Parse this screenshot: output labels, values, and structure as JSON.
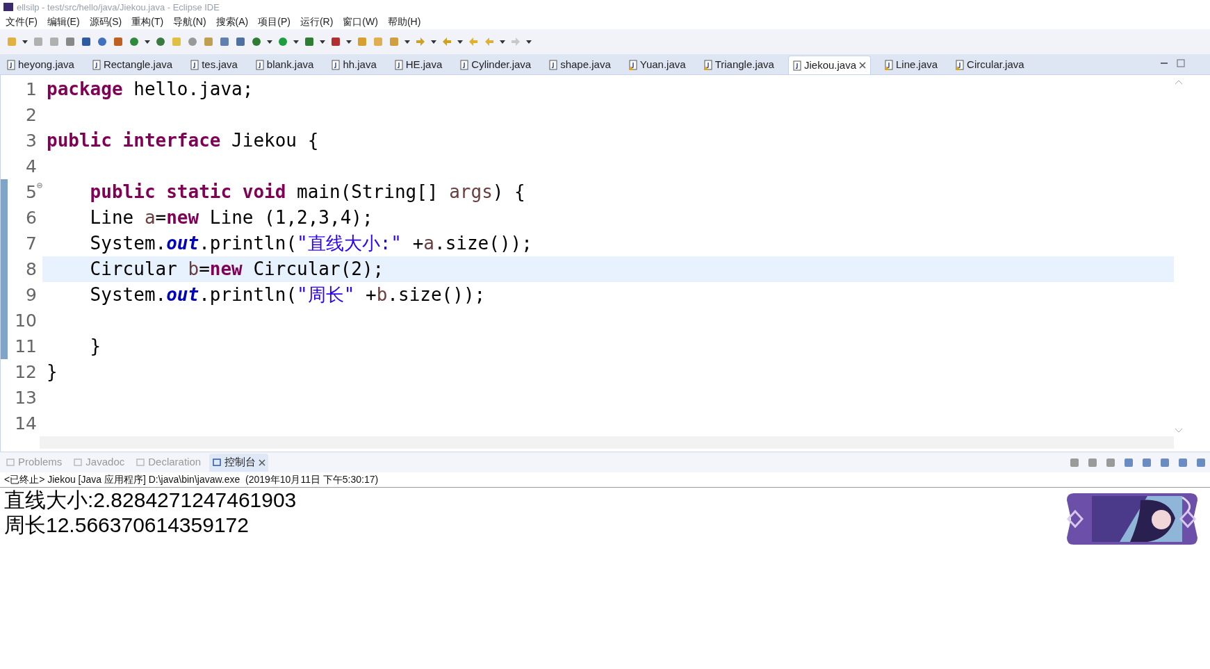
{
  "window": {
    "title": "ellsilp - test/src/hello/java/Jiekou.java - Eclipse IDE"
  },
  "menu": [
    "文件(F)",
    "编辑(E)",
    "源码(S)",
    "重构(T)",
    "导航(N)",
    "搜索(A)",
    "项目(P)",
    "运行(R)",
    "窗口(W)",
    "帮助(H)"
  ],
  "editor_tabs": [
    {
      "label": "heyong.java",
      "selected": false,
      "warning": false
    },
    {
      "label": "Rectangle.java",
      "selected": false,
      "warning": false
    },
    {
      "label": "tes.java",
      "selected": false,
      "warning": false
    },
    {
      "label": "blank.java",
      "selected": false,
      "warning": false
    },
    {
      "label": "hh.java",
      "selected": false,
      "warning": false
    },
    {
      "label": "HE.java",
      "selected": false,
      "warning": false
    },
    {
      "label": "Cylinder.java",
      "selected": false,
      "warning": false
    },
    {
      "label": "shape.java",
      "selected": false,
      "warning": false
    },
    {
      "label": "Yuan.java",
      "selected": false,
      "warning": true
    },
    {
      "label": "Triangle.java",
      "selected": false,
      "warning": true
    },
    {
      "label": "Jiekou.java",
      "selected": true,
      "warning": false
    },
    {
      "label": "Line.java",
      "selected": false,
      "warning": true
    },
    {
      "label": "Circular.java",
      "selected": false,
      "warning": true
    }
  ],
  "code_lines": [
    {
      "number": "1",
      "selected": false,
      "changed": false,
      "foldable": false,
      "tokens": [
        {
          "kind": "kw",
          "text": "package"
        },
        {
          "kind": "plain",
          "text": " hello.java;"
        }
      ]
    },
    {
      "number": "2",
      "selected": false,
      "changed": false,
      "foldable": false
    },
    {
      "number": "3",
      "selected": false,
      "changed": false,
      "foldable": false,
      "tokens": [
        {
          "kind": "kw",
          "text": "public interface"
        },
        {
          "kind": "plain",
          "text": " Jiekou {"
        }
      ]
    },
    {
      "number": "4",
      "selected": false,
      "changed": false,
      "foldable": false
    },
    {
      "number": "5",
      "selected": false,
      "changed": true,
      "foldable": true,
      "tokens": [
        {
          "kind": "kw",
          "text": "    public static void"
        },
        {
          "kind": "plain",
          "text": " main(String[] "
        },
        {
          "kind": "var",
          "text": "args"
        },
        {
          "kind": "plain",
          "text": ") {"
        }
      ]
    },
    {
      "number": "6",
      "selected": false,
      "changed": true,
      "foldable": false,
      "tokens": [
        {
          "kind": "plain",
          "text": "    Line "
        },
        {
          "kind": "var",
          "text": "a"
        },
        {
          "kind": "plain",
          "text": "="
        },
        {
          "kind": "kw",
          "text": "new"
        },
        {
          "kind": "plain",
          "text": " Line (1,2,3,4);"
        }
      ]
    },
    {
      "number": "7",
      "selected": false,
      "changed": true,
      "foldable": false,
      "tokens": [
        {
          "kind": "plain",
          "text": "    System."
        },
        {
          "kind": "field",
          "text": "out"
        },
        {
          "kind": "plain",
          "text": ".println("
        },
        {
          "kind": "str",
          "text": "\"直线大小:\""
        },
        {
          "kind": "plain",
          "text": " +"
        },
        {
          "kind": "var",
          "text": "a"
        },
        {
          "kind": "plain",
          "text": ".size());"
        }
      ]
    },
    {
      "number": "8",
      "selected": true,
      "changed": true,
      "foldable": false,
      "tokens": [
        {
          "kind": "plain",
          "text": "    Circular "
        },
        {
          "kind": "var",
          "text": "b"
        },
        {
          "kind": "plain",
          "text": "="
        },
        {
          "kind": "kw",
          "text": "new"
        },
        {
          "kind": "plain",
          "text": " Circular(2);"
        }
      ]
    },
    {
      "number": "9",
      "selected": false,
      "changed": true,
      "foldable": false,
      "tokens": [
        {
          "kind": "plain",
          "text": "    System."
        },
        {
          "kind": "field",
          "text": "out"
        },
        {
          "kind": "plain",
          "text": ".println("
        },
        {
          "kind": "str",
          "text": "\"周长\""
        },
        {
          "kind": "plain",
          "text": " +"
        },
        {
          "kind": "var",
          "text": "b"
        },
        {
          "kind": "plain",
          "text": ".size());"
        }
      ]
    },
    {
      "number": "10",
      "selected": false,
      "changed": true,
      "foldable": false
    },
    {
      "number": "11",
      "selected": false,
      "changed": true,
      "foldable": false,
      "tokens": [
        {
          "kind": "plain",
          "text": "    }"
        }
      ]
    },
    {
      "number": "12",
      "selected": false,
      "changed": false,
      "foldable": false,
      "tokens": [
        {
          "kind": "plain",
          "text": "}"
        }
      ]
    },
    {
      "number": "13",
      "selected": false,
      "changed": false,
      "foldable": false
    },
    {
      "number": "14",
      "selected": false,
      "changed": false,
      "foldable": false
    }
  ],
  "bottom_tabs": [
    {
      "label": "Problems",
      "selected": false
    },
    {
      "label": "Javadoc",
      "selected": false
    },
    {
      "label": "Declaration",
      "selected": false
    },
    {
      "label": "控制台",
      "selected": true
    }
  ],
  "console": {
    "header": "<已终止> Jiekou [Java 应用程序] D:\\java\\bin\\javaw.exe  (2019年10月11日 下午5:30:17)",
    "output": [
      "直线大小:2.8284271247461903",
      "周长12.566370614359172"
    ]
  }
}
